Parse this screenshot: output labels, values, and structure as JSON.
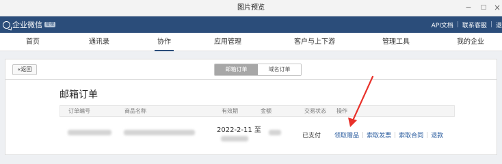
{
  "window": {
    "title": "图片预览",
    "minimize": "−",
    "maximize": "□",
    "close": "×"
  },
  "header": {
    "brand": "企业微信",
    "badge": "管理",
    "links": [
      "API文档",
      "联系客服",
      "退"
    ]
  },
  "nav": {
    "tabs": [
      "首页",
      "通讯录",
      "协作",
      "应用管理",
      "客户与上下游",
      "管理工具",
      "我的企业"
    ],
    "active": "协作"
  },
  "toolbar": {
    "back_label": "«返回",
    "segments": [
      "邮箱订单",
      "域名订单"
    ],
    "selected_segment": "邮箱订单"
  },
  "main": {
    "title": "邮箱订单",
    "columns": [
      "订单编号",
      "商品名称",
      "有效期",
      "金额",
      "交易状态",
      "操作"
    ],
    "row": {
      "validity_line1": "2022-2-11 至",
      "status": "已支付",
      "actions": [
        "领取赠品",
        "索取发票",
        "索取合同",
        "退款"
      ]
    }
  },
  "annotation": {
    "color": "#e8312a"
  }
}
